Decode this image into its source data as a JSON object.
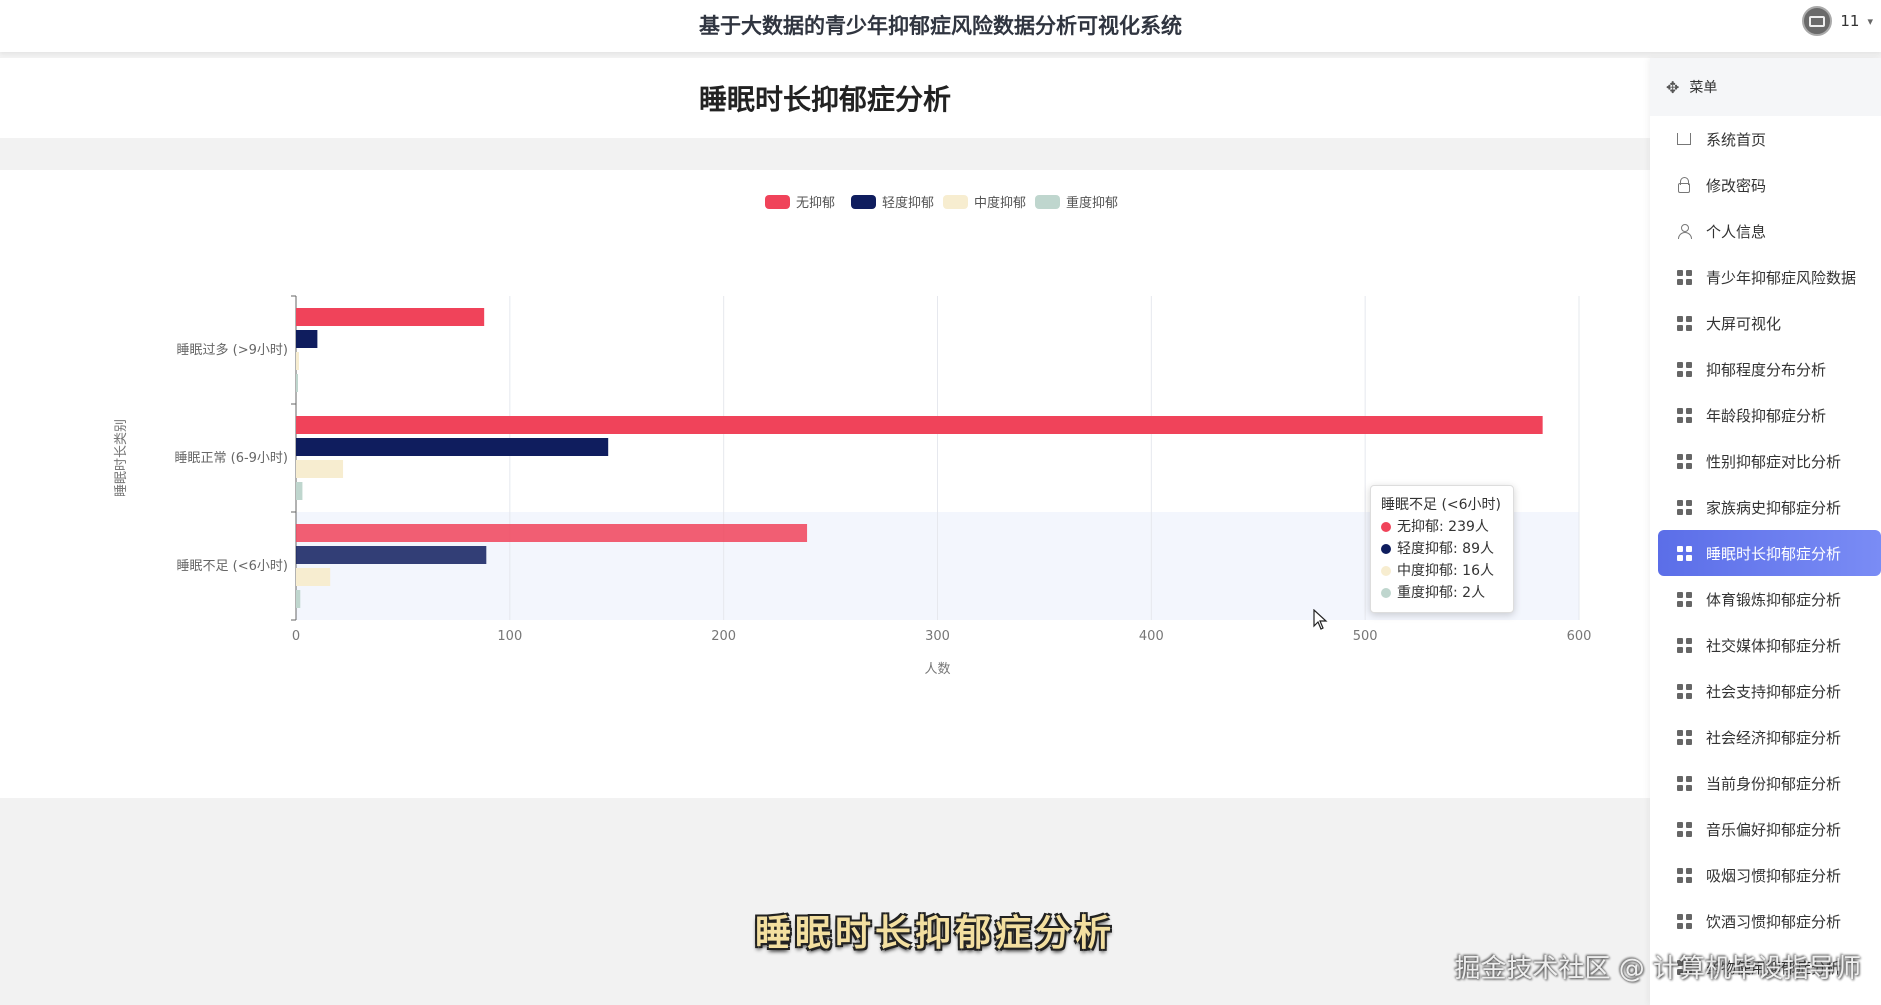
{
  "header": {
    "app_title": "基于大数据的青少年抑郁症风险数据分析可视化系统",
    "user_name": "11",
    "caret": "▾"
  },
  "page": {
    "title": "睡眠时长抑郁症分析"
  },
  "colors": {
    "none": "#f0435a",
    "mild": "#0f1d5e",
    "moderate": "#f7edd0",
    "severe": "#bfd6ce",
    "active_menu": "#6b7ef0"
  },
  "chart_data": {
    "type": "bar",
    "orientation": "horizontal",
    "categories": [
      "睡眠不足 (<6小时)",
      "睡眠正常 (6-9小时)",
      "睡眠过多 (>9小时)"
    ],
    "series": [
      {
        "name": "无抑郁",
        "values": [
          239,
          583,
          88
        ]
      },
      {
        "name": "轻度抑郁",
        "values": [
          89,
          146,
          10
        ]
      },
      {
        "name": "中度抑郁",
        "values": [
          16,
          22,
          1
        ]
      },
      {
        "name": "重度抑郁",
        "values": [
          2,
          3,
          0
        ]
      }
    ],
    "xlabel": "人数",
    "ylabel": "睡眠时长类别",
    "xlim": [
      0,
      600
    ],
    "xticks": [
      0,
      100,
      200,
      300,
      400,
      500,
      600
    ],
    "grid": true,
    "legend": "top-center",
    "highlighted_category": "睡眠不足 (<6小时)"
  },
  "tooltip": {
    "title": "睡眠不足 (<6小时)",
    "rows": [
      {
        "text": "无抑郁: 239人"
      },
      {
        "text": "轻度抑郁: 89人"
      },
      {
        "text": "中度抑郁: 16人"
      },
      {
        "text": "重度抑郁: 2人"
      }
    ]
  },
  "sidebar": {
    "header": "菜单",
    "items": [
      {
        "label": "系统首页",
        "icon": "home-icon"
      },
      {
        "label": "修改密码",
        "icon": "lock-icon"
      },
      {
        "label": "个人信息",
        "icon": "user-icon"
      },
      {
        "label": "青少年抑郁症风险数据",
        "icon": "grid-icon"
      },
      {
        "label": "大屏可视化",
        "icon": "grid-icon"
      },
      {
        "label": "抑郁程度分布分析",
        "icon": "grid-icon"
      },
      {
        "label": "年龄段抑郁症分析",
        "icon": "grid-icon"
      },
      {
        "label": "性别抑郁症对比分析",
        "icon": "grid-icon"
      },
      {
        "label": "家族病史抑郁症分析",
        "icon": "grid-icon"
      },
      {
        "label": "睡眠时长抑郁症分析",
        "icon": "grid-icon",
        "active": true
      },
      {
        "label": "体育锻炼抑郁症分析",
        "icon": "grid-icon"
      },
      {
        "label": "社交媒体抑郁症分析",
        "icon": "grid-icon"
      },
      {
        "label": "社会支持抑郁症分析",
        "icon": "grid-icon"
      },
      {
        "label": "社会经济抑郁症分析",
        "icon": "grid-icon"
      },
      {
        "label": "当前身份抑郁症分析",
        "icon": "grid-icon"
      },
      {
        "label": "音乐偏好抑郁症分析",
        "icon": "grid-icon"
      },
      {
        "label": "吸烟习惯抑郁症分析",
        "icon": "grid-icon"
      },
      {
        "label": "饮酒习惯抑郁症分析",
        "icon": "grid-icon"
      },
      {
        "label": "药物使用抑郁症分析",
        "icon": "grid-icon"
      }
    ]
  },
  "overlay": {
    "caption": "睡眠时长抑郁症分析",
    "watermark": "掘金技术社区 @ 计算机毕设指导师"
  }
}
